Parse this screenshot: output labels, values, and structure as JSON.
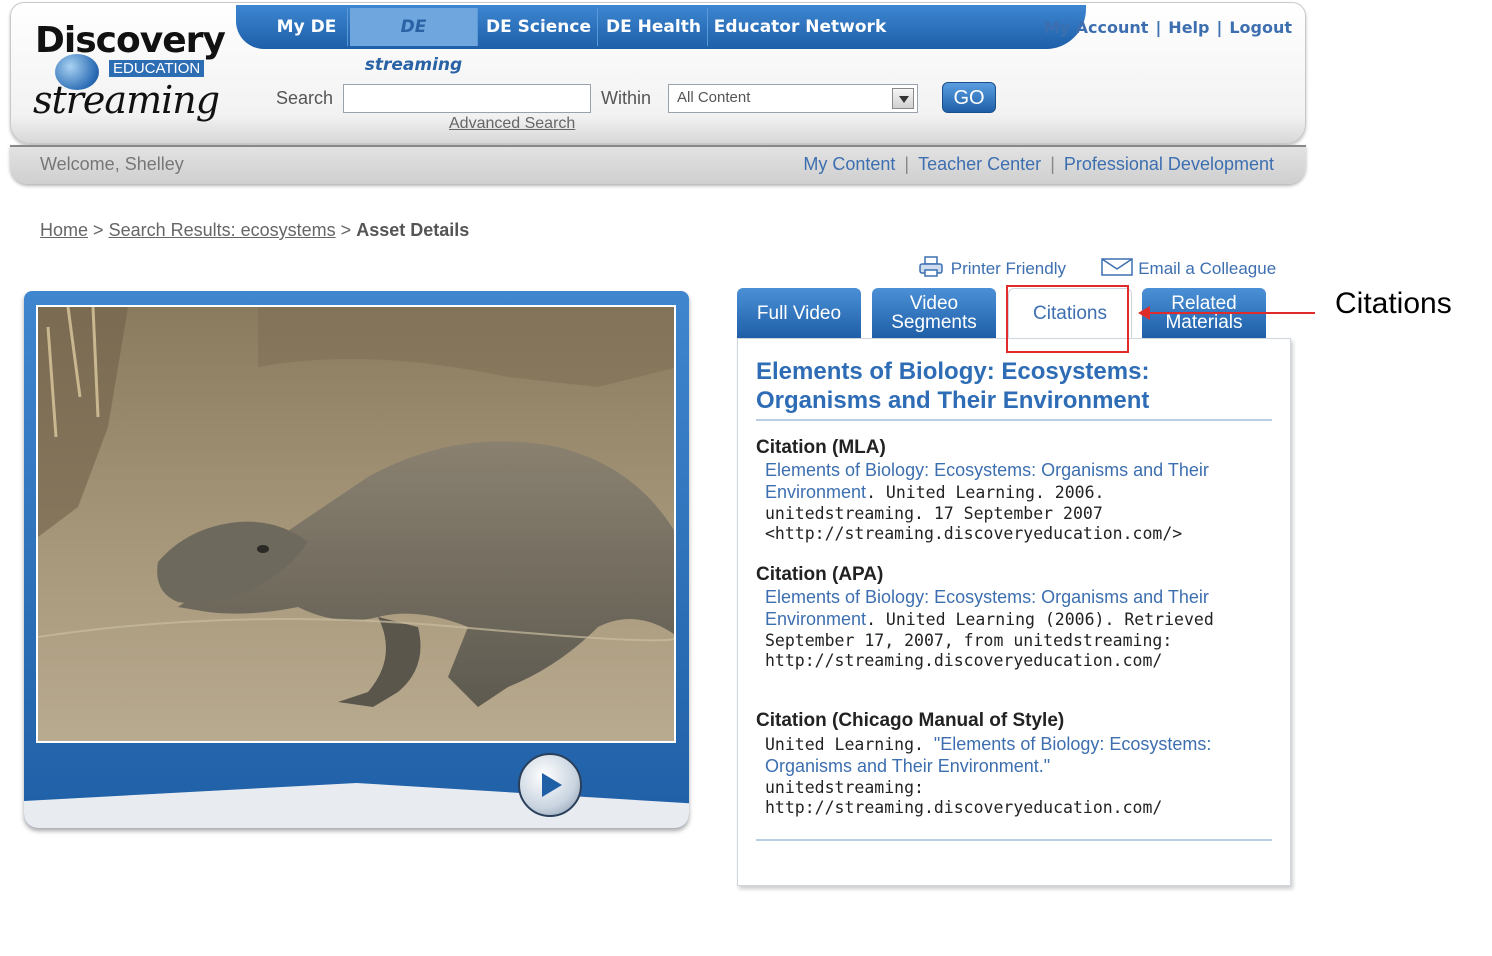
{
  "brand": {
    "logo_word1": "Discovery",
    "logo_word2": "EDUCATION",
    "logo_word3": "streaming"
  },
  "nav": {
    "items": [
      {
        "label": "My DE"
      },
      {
        "label": "DE streaming"
      },
      {
        "label": "DE Science"
      },
      {
        "label": "DE Health"
      },
      {
        "label": "Educator Network"
      }
    ],
    "active_index": 1
  },
  "account_links": [
    "My Account",
    "Help",
    "Logout"
  ],
  "search": {
    "label": "Search",
    "value": "",
    "within_label": "Within",
    "within_value": "All Content",
    "go_label": "GO",
    "advanced_label": "Advanced Search"
  },
  "subbar": {
    "welcome": "Welcome, Shelley",
    "links": [
      "My Content",
      "Teacher Center",
      "Professional Development"
    ]
  },
  "breadcrumb": {
    "home": "Home",
    "sep": ">",
    "results": "Search Results: ecosystems",
    "current": "Asset Details"
  },
  "utilities": {
    "printer": "Printer Friendly",
    "email": "Email a Colleague"
  },
  "tabs": [
    {
      "label": "Full Video"
    },
    {
      "label": "Video Segments"
    },
    {
      "label": "Citations"
    },
    {
      "label": "Related Materials"
    }
  ],
  "asset": {
    "title": "Elements of Biology: Ecosystems: Organisms and Their Environment"
  },
  "citations": {
    "mla": {
      "heading": "Citation (MLA)",
      "title": "Elements of Biology: Ecosystems: Organisms and Their Environment",
      "rest": ". United Learning. 2006. unitedstreaming. 17 September 2007 <http://streaming.discoveryeducation.com/>"
    },
    "apa": {
      "heading": "Citation (APA)",
      "title": "Elements of Biology: Ecosystems: Organisms and Their Environment",
      "rest": ". United Learning (2006). Retrieved September 17, 2007, from unitedstreaming: http://streaming.discoveryeducation.com/"
    },
    "chicago": {
      "heading": "Citation (Chicago Manual of Style)",
      "prefix": "United Learning. ",
      "title": "\"Elements of Biology: Ecosystems: Organisms and Their Environment.\"",
      "rest": " unitedstreaming: http://streaming.discoveryeducation.com/"
    }
  },
  "annotation": {
    "label": "Citations",
    "color": "#e02b2b"
  },
  "colors": {
    "brand_blue": "#1e5fa8",
    "link_blue": "#3d6fb0"
  }
}
